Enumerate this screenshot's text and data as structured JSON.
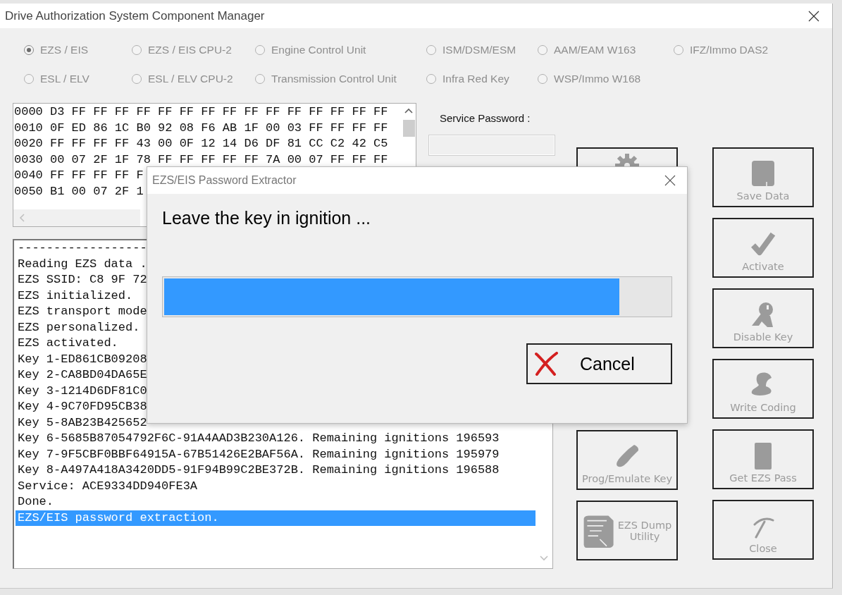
{
  "window": {
    "title": "Drive Authorization System Component Manager"
  },
  "modules": [
    {
      "label": "EZS / EIS",
      "selected": true,
      "disabled": true
    },
    {
      "label": "EZS / EIS CPU-2",
      "selected": false,
      "disabled": true
    },
    {
      "label": "Engine Control Unit",
      "selected": false,
      "disabled": true
    },
    {
      "label": "ISM/DSM/ESM",
      "selected": false,
      "disabled": true
    },
    {
      "label": "AAM/EAM W163",
      "selected": false,
      "disabled": true
    },
    {
      "label": "IFZ/Immo DAS2",
      "selected": false,
      "disabled": true
    },
    {
      "label": "ESL / ELV",
      "selected": false,
      "disabled": true
    },
    {
      "label": "ESL / ELV CPU-2",
      "selected": false,
      "disabled": true
    },
    {
      "label": "Transmission Control Unit",
      "selected": false,
      "disabled": true
    },
    {
      "label": "Infra Red Key",
      "selected": false,
      "disabled": true
    },
    {
      "label": "WSP/Immo W168",
      "selected": false,
      "disabled": true
    }
  ],
  "hex_dump": [
    "0000 D3 FF FF FF FF FF FF FF FF FF FF FF FF FF FF FF",
    "0010 0F ED 86 1C B0 92 08 F6 AB 1F 00 03 FF FF FF FF",
    "0020 FF FF FF FF 43 00 0F 12 14 D6 DF 81 CC C2 42 C5",
    "0030 00 07 2F 1F 78 FF FF FF FF FF 7A 00 07 FF FF FF",
    "0040 FF FF FF FF F",
    "0050 B1 00 07 2F 1"
  ],
  "service_password": {
    "label": "Service Password :"
  },
  "log": [
    {
      "text": "------------------",
      "selected": false
    },
    {
      "text": "Reading EZS data .",
      "selected": false
    },
    {
      "text": "EZS SSID: C8 9F 72",
      "selected": false
    },
    {
      "text": "EZS initialized.",
      "selected": false
    },
    {
      "text": "EZS transport mode",
      "selected": false
    },
    {
      "text": "EZS personalized.",
      "selected": false
    },
    {
      "text": "EZS activated.",
      "selected": false
    },
    {
      "text": "Key 1-ED861CB09208",
      "selected": false
    },
    {
      "text": "Key 2-CA8BD04DA65E",
      "selected": false
    },
    {
      "text": "Key 3-1214D6DF81C0",
      "selected": false
    },
    {
      "text": "Key 4-9C70FD95CB38",
      "selected": false
    },
    {
      "text": "Key 5-8AB23B425652",
      "selected": false
    },
    {
      "text": "Key 6-5685B87054792F6C-91A4AAD3B230A126. Remaining ignitions 196593",
      "selected": false
    },
    {
      "text": "Key 7-9F5CBF0BBF64915A-67B51426E2BAF56A. Remaining ignitions 195979",
      "selected": false
    },
    {
      "text": "Key 8-A497A418A3420DD5-91F94B99C2BE372B. Remaining ignitions 196588",
      "selected": false
    },
    {
      "text": "Service: ACE9334DD940FE3A",
      "selected": false
    },
    {
      "text": "Done.",
      "selected": false
    },
    {
      "text": "EZS/EIS password extraction.",
      "selected": true
    }
  ],
  "tool_buttons_left": [
    {
      "kind": "gear",
      "disabled": true
    },
    {
      "label": "Prog/Emulate Key",
      "kind": "remote",
      "disabled": true
    },
    {
      "label": "EZS Dump Utility",
      "kind": "chip",
      "disabled": true
    }
  ],
  "tool_buttons_right": [
    {
      "label": "Save Data",
      "kind": "floppy",
      "disabled": true
    },
    {
      "label": "Activate",
      "kind": "check",
      "disabled": true
    },
    {
      "label": "Disable Key",
      "kind": "key",
      "disabled": true
    },
    {
      "label": "Write Coding",
      "kind": "stamp",
      "disabled": true
    },
    {
      "label": "Get EZS Pass",
      "kind": "card",
      "disabled": true
    },
    {
      "label": "Close",
      "kind": "pick",
      "disabled": true
    }
  ],
  "dialog": {
    "title": "EZS/EIS Password Extractor",
    "message": "Leave the key in ignition ...",
    "progress": {
      "level": 0.9
    },
    "button": "Cancel"
  }
}
